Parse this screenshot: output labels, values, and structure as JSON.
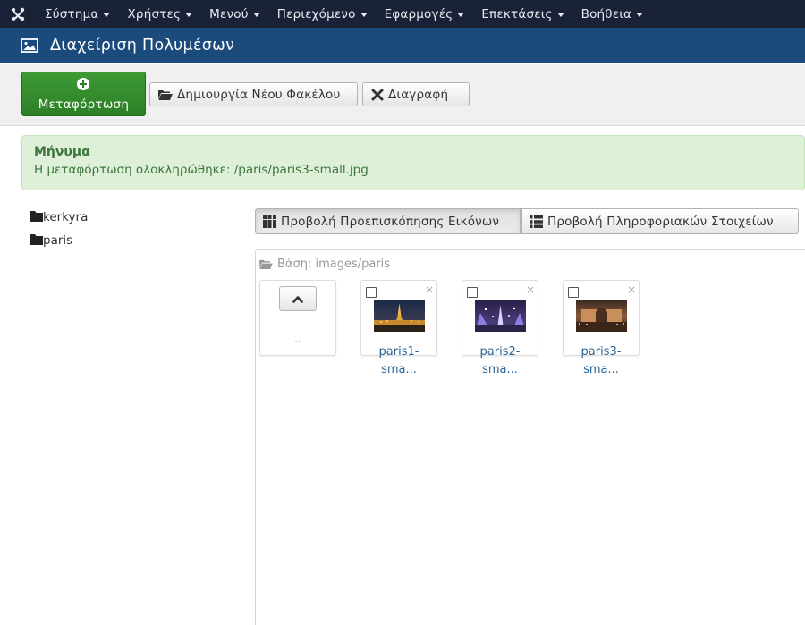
{
  "topnav": {
    "logo_icon": "joomla-icon",
    "items": [
      {
        "label": "Σύστημα"
      },
      {
        "label": "Χρήστες"
      },
      {
        "label": "Μενού"
      },
      {
        "label": "Περιεχόμενο"
      },
      {
        "label": "Εφαρμογές"
      },
      {
        "label": "Επεκτάσεις"
      },
      {
        "label": "Βοήθεια"
      }
    ]
  },
  "header": {
    "icon": "image-icon",
    "title": "Διαχείριση Πολυμέσων"
  },
  "toolbar": {
    "upload_label": "Μεταφόρτωση",
    "new_folder_label": "Δημιουργία Νέου Φακέλου",
    "delete_label": "Διαγραφή"
  },
  "alert": {
    "heading": "Μήνυμα",
    "text": "Η μεταφόρτωση ολοκληρώθηκε: /paris/paris3-small.jpg"
  },
  "tree": {
    "folders": [
      {
        "label": "kerkyra"
      },
      {
        "label": "paris"
      }
    ]
  },
  "views": {
    "thumbs_label": "Προβολή Προεπισκόπησης Εικόνων",
    "details_label": "Προβολή Πληροφοριακών Στοιχείων"
  },
  "media": {
    "breadcrumb": "Βάση: images/paris",
    "up_label": "..",
    "files": [
      {
        "caption_line1": "paris1-",
        "caption_line2": "sma..."
      },
      {
        "caption_line1": "paris2-",
        "caption_line2": "sma..."
      },
      {
        "caption_line1": "paris3-",
        "caption_line2": "sma..."
      }
    ]
  },
  "colors": {
    "topnav_bg": "#1a2237",
    "header_bg": "#1b4b7d",
    "upload_green": "#2d7f26",
    "alert_bg": "#dff0d8",
    "alert_text": "#3c763d",
    "link": "#2a6496"
  }
}
